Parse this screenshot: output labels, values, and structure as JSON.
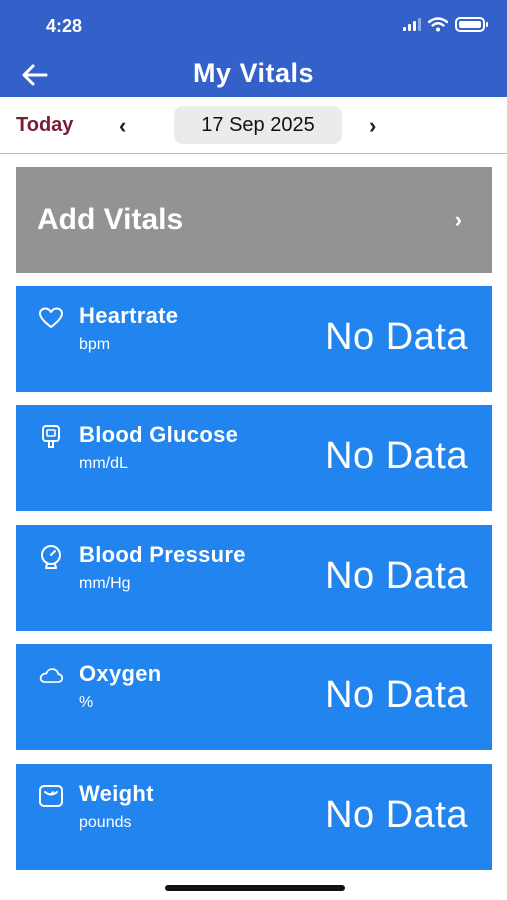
{
  "status_bar": {
    "time": "4:28"
  },
  "header": {
    "title": "My Vitals",
    "back_icon": "arrow-left-icon"
  },
  "date_nav": {
    "today_label": "Today",
    "prev": "‹",
    "date": "17 Sep 2025",
    "next": "›"
  },
  "add_vitals": {
    "label": "Add Vitals",
    "chevron": "›"
  },
  "vitals": [
    {
      "name": "Heartrate",
      "unit": "bpm",
      "value": "No Data",
      "icon": "heart-icon"
    },
    {
      "name": "Blood Glucose",
      "unit": "mm/dL",
      "value": "No Data",
      "icon": "glucose-meter-icon"
    },
    {
      "name": "Blood Pressure",
      "unit": "mm/Hg",
      "value": "No Data",
      "icon": "pressure-gauge-icon"
    },
    {
      "name": "Oxygen",
      "unit": "%",
      "value": "No Data",
      "icon": "cloud-icon"
    },
    {
      "name": "Weight",
      "unit": "pounds",
      "value": "No Data",
      "icon": "scale-icon"
    }
  ],
  "colors": {
    "header": "#3461c9",
    "card": "#2284ee",
    "add_card": "#919395",
    "today": "#7a1c32"
  }
}
